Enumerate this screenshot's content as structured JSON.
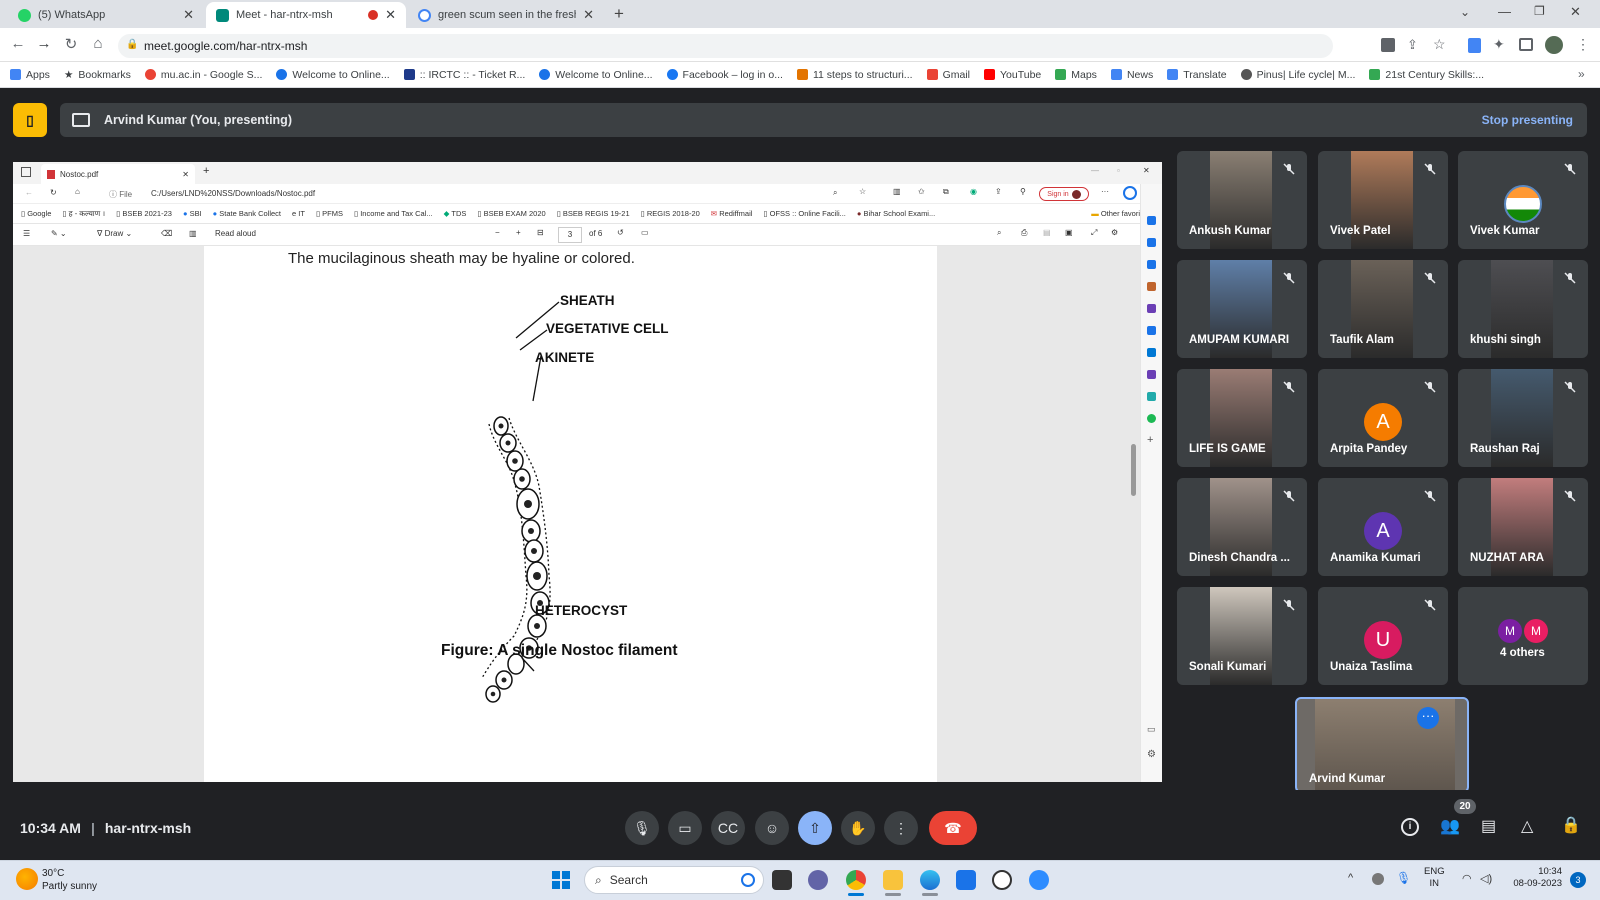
{
  "browser": {
    "tabs": [
      {
        "title": "(5) WhatsApp",
        "color": "#25d366"
      },
      {
        "title": "Meet - har-ntrx-msh",
        "color": "#00897b"
      },
      {
        "title": "green scum seen in the freshwat",
        "color": "#4285f4"
      }
    ],
    "url": "meet.google.com/har-ntrx-msh",
    "bookmarks": [
      "Apps",
      "Bookmarks",
      "mu.ac.in - Google S...",
      "Welcome to Online...",
      ":: IRCTC :: - Ticket R...",
      "Welcome to Online...",
      "Facebook – log in o...",
      "11 steps to structuri...",
      "Gmail",
      "YouTube",
      "Maps",
      "News",
      "Translate",
      "Pinus| Life cycle| M...",
      "21st Century Skills:..."
    ]
  },
  "meet": {
    "presenting_label": "Arvind Kumar (You, presenting)",
    "stop_label": "Stop presenting",
    "time": "10:34 AM",
    "meeting_code": "har-ntrx-msh",
    "participant_count": "20",
    "participants": [
      {
        "name": "Ankush Kumar",
        "type": "video",
        "color": "#8a7f73"
      },
      {
        "name": "Vivek Patel",
        "type": "video",
        "color": "#b07b5a"
      },
      {
        "name": "Vivek Kumar",
        "type": "avatar-img",
        "color": "#5b88c0"
      },
      {
        "name": "AMUPAM KUMARI",
        "type": "video",
        "color": "#5f7fa8"
      },
      {
        "name": "Taufik Alam",
        "type": "video",
        "color": "#6a6158"
      },
      {
        "name": "khushi singh",
        "type": "video",
        "color": "#4e4e52"
      },
      {
        "name": "LIFE IS GAME",
        "type": "video",
        "color": "#9a7c74"
      },
      {
        "name": "Arpita Pandey",
        "type": "avatar",
        "initial": "A",
        "color": "#f57c00"
      },
      {
        "name": "Raushan Raj",
        "type": "video",
        "color": "#455a6e"
      },
      {
        "name": "Dinesh Chandra ...",
        "type": "video",
        "color": "#a0928a"
      },
      {
        "name": "Anamika Kumari",
        "type": "avatar",
        "initial": "A",
        "color": "#5e35b1"
      },
      {
        "name": "NUZHAT ARA",
        "type": "video",
        "color": "#c27d7d"
      },
      {
        "name": "Sonali Kumari",
        "type": "video",
        "color": "#cfc7bd"
      },
      {
        "name": "Unaiza Taslima",
        "type": "avatar",
        "initial": "U",
        "color": "#d81b60"
      },
      {
        "name": "4 others",
        "type": "others",
        "initials": [
          "M",
          "M"
        ],
        "colors": [
          "#7b1fa2",
          "#e91e63"
        ]
      }
    ],
    "self_name": "Arvind Kumar"
  },
  "shared": {
    "tab_title": "Nostoc.pdf",
    "file_label": "File",
    "path": "C:/Users/LND%20NSS/Downloads/Nostoc.pdf",
    "signin": "Sign in",
    "bookmarks": [
      "Google",
      "ह - कल्याण ।",
      "BSEB 2021-23",
      "SBI",
      "State Bank Collect",
      "IT",
      "PFMS",
      "Income and Tax Cal...",
      "TDS",
      "BSEB EXAM 2020",
      "BSEB REGIS 19-21",
      "REGIS 2018-20",
      "Rediffmail",
      "OFSS :: Online Facili...",
      "Bihar School Exami...",
      "Other favorites"
    ],
    "pdf_draw": "Draw",
    "pdf_read": "Read aloud",
    "page_num": "3",
    "page_total": "of 6",
    "sheath_text": "The mucilaginous sheath may be hyaline or colored.",
    "labels": {
      "sheath": "SHEATH",
      "veg": "VEGETATIVE CELL",
      "akinete": "AKINETE",
      "hetero": "HETEROCYST"
    },
    "caption": "Figure: A single Nostoc filament"
  },
  "taskbar": {
    "temp": "30°C",
    "weather": "Partly sunny",
    "search": "Search",
    "lang1": "ENG",
    "lang2": "IN",
    "time": "10:34",
    "date": "08-09-2023",
    "notif": "3"
  }
}
